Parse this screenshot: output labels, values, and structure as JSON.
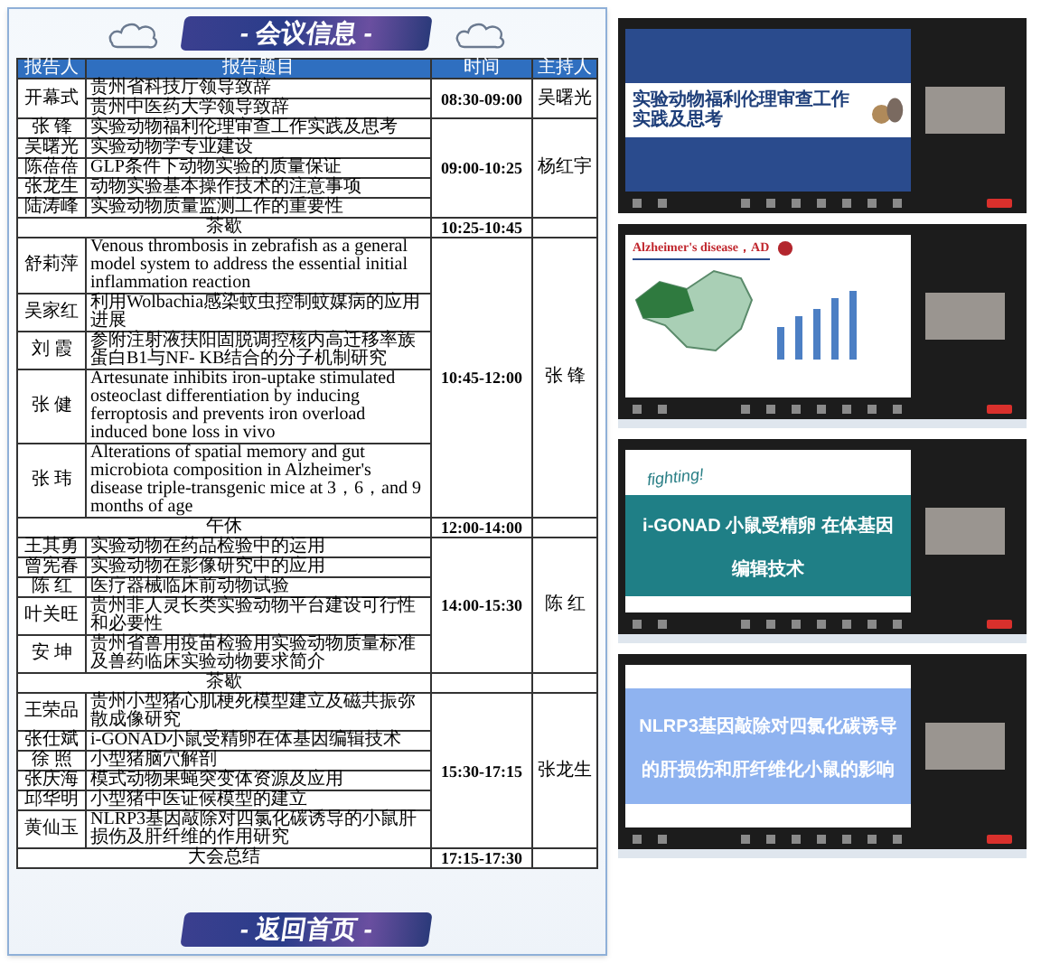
{
  "schedule": {
    "title": "- 会议信息 -",
    "columns": [
      "报告人",
      "报告题目",
      "时间",
      "主持人"
    ],
    "sessions": [
      {
        "kind": "talks",
        "time": "08:30-09:00",
        "host": "吴曙光",
        "rows": [
          {
            "speaker": "开幕式",
            "topics": [
              "贵州省科技厅领导致辞",
              "贵州中医药大学领导致辞"
            ]
          }
        ]
      },
      {
        "kind": "talks",
        "time": "09:00-10:25",
        "host": "杨红宇",
        "rows": [
          {
            "speaker": "张 锋",
            "topics": [
              "实验动物福利伦理审查工作实践及思考"
            ]
          },
          {
            "speaker": "吴曙光",
            "topics": [
              "实验动物学专业建设"
            ]
          },
          {
            "speaker": "陈蓓蓓",
            "topics": [
              "GLP条件下动物实验的质量保证"
            ]
          },
          {
            "speaker": "张龙生",
            "topics": [
              "动物实验基本操作技术的注意事项"
            ]
          },
          {
            "speaker": "陆涛峰",
            "topics": [
              "实验动物质量监测工作的重要性"
            ]
          }
        ]
      },
      {
        "kind": "break",
        "label": "茶歇",
        "time": "10:25-10:45"
      },
      {
        "kind": "talks",
        "time": "10:45-12:00",
        "host": "张 锋",
        "rows": [
          {
            "speaker": "舒莉萍",
            "topics": [
              "Venous thrombosis in zebrafish as a general model system to address the essential initial inflammation reaction"
            ]
          },
          {
            "speaker": "吴家红",
            "topics": [
              "利用Wolbachia感染蚊虫控制蚊媒病的应用进展"
            ]
          },
          {
            "speaker": "刘 霞",
            "topics": [
              "参附注射液扶阳固脱调控核内高迁移率族蛋白B1与NF- KB结合的分子机制研究"
            ]
          },
          {
            "speaker": "张 健",
            "topics": [
              "Artesunate inhibits iron-uptake stimulated osteoclast differentiation by inducing ferroptosis and prevents iron overload induced bone loss in vivo"
            ]
          },
          {
            "speaker": "张 玮",
            "topics": [
              "Alterations of spatial memory and gut microbiota composition in Alzheimer's disease triple-transgenic mice at 3，6，and 9 months of age"
            ]
          }
        ]
      },
      {
        "kind": "break",
        "label": "午休",
        "time": "12:00-14:00"
      },
      {
        "kind": "talks",
        "time": "14:00-15:30",
        "host": "陈 红",
        "rows": [
          {
            "speaker": "王其勇",
            "topics": [
              "实验动物在药品检验中的运用"
            ]
          },
          {
            "speaker": "曾宪春",
            "topics": [
              "实验动物在影像研究中的应用"
            ]
          },
          {
            "speaker": "陈 红",
            "topics": [
              "医疗器械临床前动物试验"
            ]
          },
          {
            "speaker": "叶关旺",
            "topics": [
              "贵州非人灵长类实验动物平台建设可行性和必要性"
            ]
          },
          {
            "speaker": "安 坤",
            "topics": [
              "贵州省兽用疫苗检验用实验动物质量标准及兽药临床实验动物要求简介"
            ]
          }
        ]
      },
      {
        "kind": "break",
        "label": "茶歇"
      },
      {
        "kind": "talks",
        "time": "15:30-17:15",
        "host": "张龙生",
        "rows": [
          {
            "speaker": "王荣品",
            "topics": [
              "贵州小型猪心肌梗死模型建立及磁共振弥散成像研究"
            ]
          },
          {
            "speaker": "张仕斌",
            "topics": [
              "i-GONAD小鼠受精卵在体基因编辑技术"
            ]
          },
          {
            "speaker": "徐 照",
            "topics": [
              "小型猪脑穴解剖"
            ]
          },
          {
            "speaker": "张庆海",
            "topics": [
              "模式动物果蝇突变体资源及应用"
            ]
          },
          {
            "speaker": "邱华明",
            "topics": [
              "小型猪中医证候模型的建立"
            ]
          },
          {
            "speaker": "黄仙玉",
            "topics": [
              "NLRP3基因敲除对四氯化碳诱导的小鼠肝损伤及肝纤维的作用研究"
            ]
          }
        ]
      },
      {
        "kind": "break",
        "label": "大会总结",
        "time": "17:15-17:30"
      }
    ],
    "back_button": "- 返回首页 -"
  },
  "windows": [
    {
      "kind": "banner",
      "title": "实验动物福利伦理审查工作实践及思考",
      "taskbar": false
    },
    {
      "kind": "map",
      "title": "Alzheimer's disease，AD",
      "taskbar": true
    },
    {
      "kind": "teal",
      "tag": "fighting!",
      "title": "i-GONAD 小鼠受精卵 在体基因编辑技术",
      "taskbar": true
    },
    {
      "kind": "light",
      "title": "NLRP3基因敲除对四氯化碳诱导的肝损伤和肝纤维化小鼠的影响",
      "taskbar": true
    }
  ]
}
